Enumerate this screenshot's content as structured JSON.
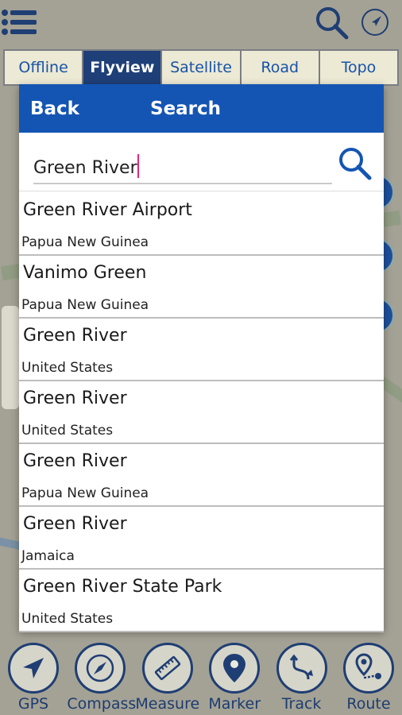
{
  "top_bar": {
    "menu_icon": "hamburger-menu-icon",
    "search_icon": "search-icon",
    "compass_icon": "navigation-arrow-icon"
  },
  "map_tabs": [
    {
      "label": "Offline",
      "active": false
    },
    {
      "label": "Flyview",
      "active": true
    },
    {
      "label": "Satellite",
      "active": false
    },
    {
      "label": "Road",
      "active": false
    },
    {
      "label": "Topo",
      "active": false
    }
  ],
  "dialog": {
    "back_label": "Back",
    "title": "Search",
    "search_value": "Green River",
    "search_placeholder": "",
    "search_button_icon": "search-icon"
  },
  "results": [
    {
      "name": "Green River Airport",
      "country": "Papua New Guinea"
    },
    {
      "name": "Vanimo Green",
      "country": "Papua New Guinea"
    },
    {
      "name": "Green River",
      "country": "United States"
    },
    {
      "name": "Green River",
      "country": "United States"
    },
    {
      "name": "Green River",
      "country": "Papua New Guinea"
    },
    {
      "name": "Green River",
      "country": "Jamaica"
    },
    {
      "name": "Green River State Park",
      "country": "United States"
    }
  ],
  "toolbar": [
    {
      "label": "GPS",
      "icon": "navigation-arrow-icon"
    },
    {
      "label": "Compass",
      "icon": "compass-icon"
    },
    {
      "label": "Measure",
      "icon": "ruler-icon"
    },
    {
      "label": "Marker",
      "icon": "map-pin-icon"
    },
    {
      "label": "Track",
      "icon": "track-path-icon"
    },
    {
      "label": "Route",
      "icon": "route-pin-icon"
    }
  ],
  "colors": {
    "header_blue": "#1455b3",
    "tab_active": "#1e3f78",
    "tab_text": "#1753a8",
    "toolbar_ink": "#1d3c70",
    "caret": "#e0287a"
  }
}
